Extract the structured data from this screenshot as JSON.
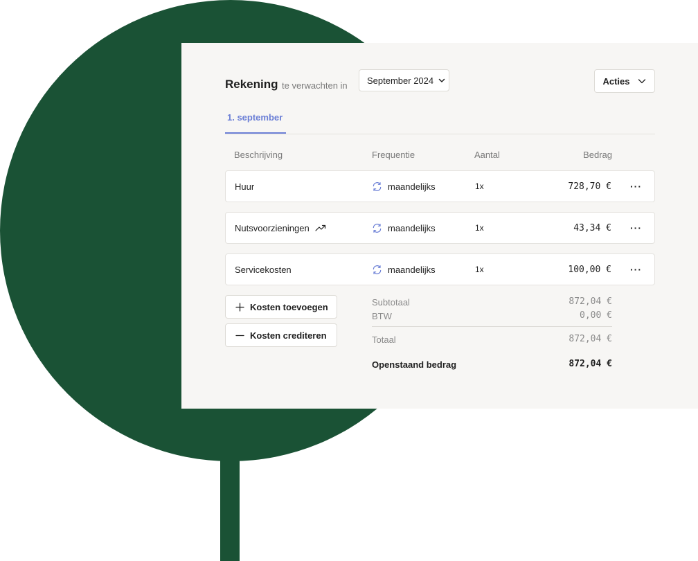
{
  "header": {
    "title": "Rekening",
    "subtitle": "te verwachten in",
    "month_select": "September 2024",
    "actions_label": "Acties"
  },
  "tabs": [
    {
      "label": "1. september",
      "active": true
    }
  ],
  "columns": {
    "description": "Beschrijving",
    "frequency": "Frequentie",
    "quantity": "Aantal",
    "amount": "Bedrag"
  },
  "rows": [
    {
      "description": "Huur",
      "trend_icon": false,
      "frequency": "maandelijks",
      "quantity": "1x",
      "amount": "728,70 €"
    },
    {
      "description": "Nutsvoorzieningen",
      "trend_icon": true,
      "frequency": "maandelijks",
      "quantity": "1x",
      "amount": "43,34 €"
    },
    {
      "description": "Servicekosten",
      "trend_icon": false,
      "frequency": "maandelijks",
      "quantity": "1x",
      "amount": "100,00 €"
    }
  ],
  "buttons": {
    "add_costs": "Kosten toevoegen",
    "credit_costs": "Kosten crediteren"
  },
  "summary": {
    "subtotal_label": "Subtotaal",
    "subtotal_value": "872,04 €",
    "vat_label": "BTW",
    "vat_value": "0,00 €",
    "total_label": "Totaal",
    "total_value": "872,04 €",
    "outstanding_label": "Openstaand bedrag",
    "outstanding_value": "872,04 €"
  },
  "icons": {
    "refresh": "refresh-icon",
    "trend": "trending-up-icon",
    "more": "more-horizontal-icon",
    "plus": "plus-icon",
    "minus": "minus-icon",
    "chevron": "chevron-down-icon"
  },
  "colors": {
    "brand_green": "#1a5235",
    "accent_blue": "#6b7fd6",
    "panel_bg": "#f7f6f4"
  }
}
